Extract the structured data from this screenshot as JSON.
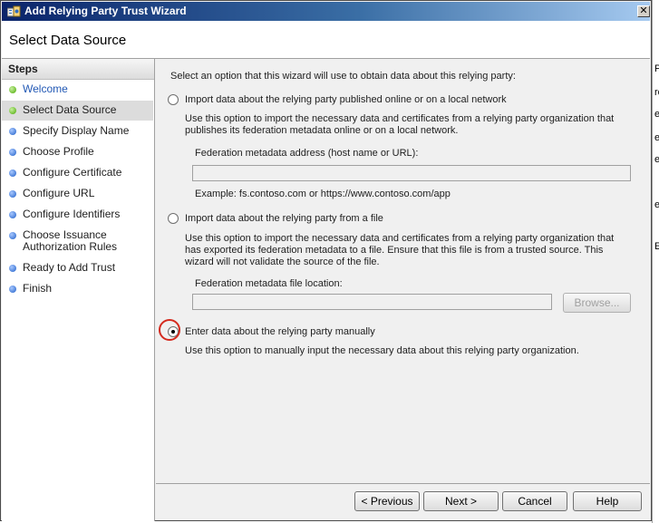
{
  "window": {
    "title": "Add Relying Party Trust Wizard",
    "close_glyph": "✕"
  },
  "header": {
    "title": "Select Data Source"
  },
  "steps": {
    "heading": "Steps",
    "items": [
      {
        "label": "Welcome",
        "state": "done"
      },
      {
        "label": "Select Data Source",
        "state": "current"
      },
      {
        "label": "Specify Display Name",
        "state": "todo"
      },
      {
        "label": "Choose Profile",
        "state": "todo"
      },
      {
        "label": "Configure Certificate",
        "state": "todo"
      },
      {
        "label": "Configure URL",
        "state": "todo"
      },
      {
        "label": "Configure Identifiers",
        "state": "todo"
      },
      {
        "label": "Choose Issuance Authorization Rules",
        "state": "todo"
      },
      {
        "label": "Ready to Add Trust",
        "state": "todo"
      },
      {
        "label": "Finish",
        "state": "todo"
      }
    ]
  },
  "content": {
    "intro": "Select an option that this wizard will use to obtain data about this relying party:",
    "option_online": {
      "label": "Import data about the relying party published online or on a local network",
      "description": "Use this option to import the necessary data and certificates from a relying party organization that publishes its federation metadata online or on a local network.",
      "field_label": "Federation metadata address (host name or URL):",
      "field_value": "",
      "example": "Example: fs.contoso.com or https://www.contoso.com/app",
      "selected": false
    },
    "option_file": {
      "label": "Import data about the relying party from a file",
      "description": "Use this option to import the necessary data and certificates from a relying party organization that has exported its federation metadata to a file. Ensure that this file is from a trusted source.  This wizard will not validate the source of the file.",
      "field_label": "Federation metadata file location:",
      "field_value": "",
      "browse_label": "Browse...",
      "selected": false
    },
    "option_manual": {
      "label": "Enter data about the relying party manually",
      "description": "Use this option to manually input the necessary data about this relying party organization.",
      "selected": true
    }
  },
  "footer": {
    "previous_label": "< Previous",
    "next_label": "Next >",
    "cancel_label": "Cancel",
    "help_label": "Help"
  },
  "background_fragments": [
    "P",
    "ro",
    "e",
    "e",
    "e",
    "e",
    "E"
  ],
  "colors": {
    "title_bar_start": "#0a246a",
    "title_bar_end": "#a6caf0",
    "step_link": "#2359b5",
    "step_done_dot": "#48a800",
    "step_todo_dot": "#1f5fc8",
    "annotation_circle": "#d42a1e"
  }
}
